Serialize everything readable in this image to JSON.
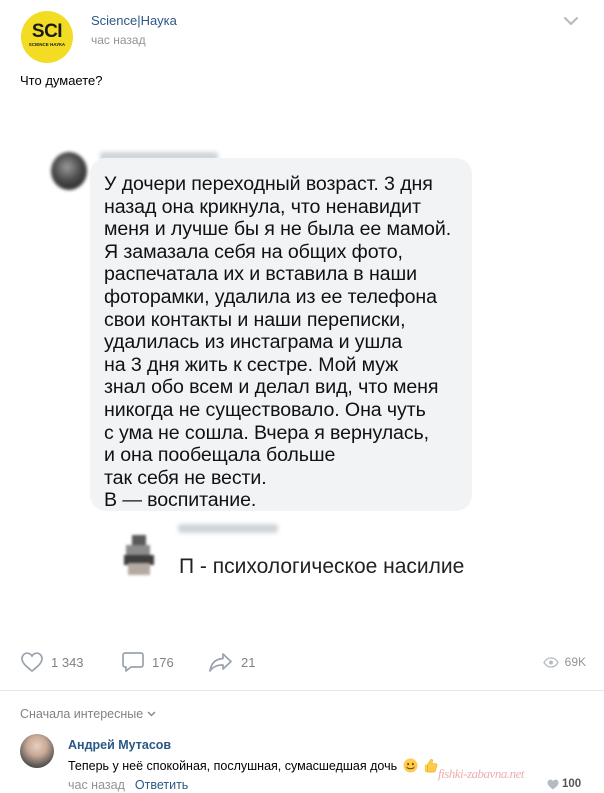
{
  "post": {
    "page_name": "Science|Наука",
    "logo": {
      "main": "SCI",
      "sub": "SCIENCE НАУКА"
    },
    "time": "час назад",
    "text": "Что думаете?",
    "menu_icon": "chevron-down-icon"
  },
  "screenshot": {
    "message_lines": [
      "У дочери переходный возраст. 3 дня",
      "назад она крикнула, что ненавидит",
      "меня и лучше бы я не была ее мамой.",
      "Я замазала себя на общих фото,",
      "распечатала их и вставила в наши",
      "фоторамки, удалила из ее телефона",
      "свои контакты и наши переписки,",
      "удалилась из инстаграма и ушла",
      "на 3 дня жить к сестре. Мой муж",
      "знал обо всем и делал вид, что меня",
      "никогда не существовало. Она чуть",
      "с ума не сошла. Вчера я вернулась,",
      "и она пообещала больше",
      "так себя не вести.",
      "В — воспитание."
    ],
    "reply_text": "П - психологическое насилие"
  },
  "actions": {
    "likes": "1 343",
    "comments": "176",
    "shares": "21",
    "views": "69K"
  },
  "comments_section": {
    "sort_label": "Сначала интересные",
    "comment": {
      "author": "Андрей Мутасов",
      "text": "Теперь у неё спокойная, послушная, сумасшедшая дочь",
      "time": "час назад",
      "reply_label": "Ответить",
      "likes": "100"
    }
  },
  "watermark": "fishki-zabavna.net",
  "colors": {
    "link": "#2a5885",
    "muted": "#828282",
    "logo_bg": "#f2dc24",
    "bubble": "#f1f3f5"
  }
}
